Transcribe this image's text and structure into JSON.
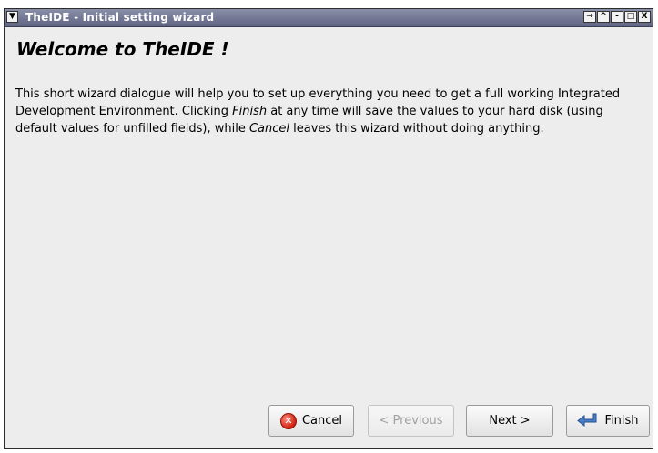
{
  "window": {
    "title": "TheIDE - Initial setting wizard",
    "menu_icon": "chevron-down-icon",
    "wm_buttons": [
      "→",
      "^",
      "-",
      "□",
      "X"
    ]
  },
  "content": {
    "heading": "Welcome to TheIDE !",
    "text_1": "This short wizard dialogue will help you to set up everything you need to get a full working Integrated Development Environment. Clicking ",
    "text_em_finish": "Finish",
    "text_2": " at any time will save the values to your hard disk (using default values for unfilled fields), while ",
    "text_em_cancel": "Cancel",
    "text_3": " leaves this wizard without doing anything."
  },
  "buttons": {
    "cancel": "Cancel",
    "previous": "< Previous",
    "next": "Next >",
    "finish": "Finish"
  },
  "colors": {
    "titlebar": "#6f748f",
    "cancel_icon": "#d0200f",
    "finish_icon": "#4a7fc8"
  }
}
